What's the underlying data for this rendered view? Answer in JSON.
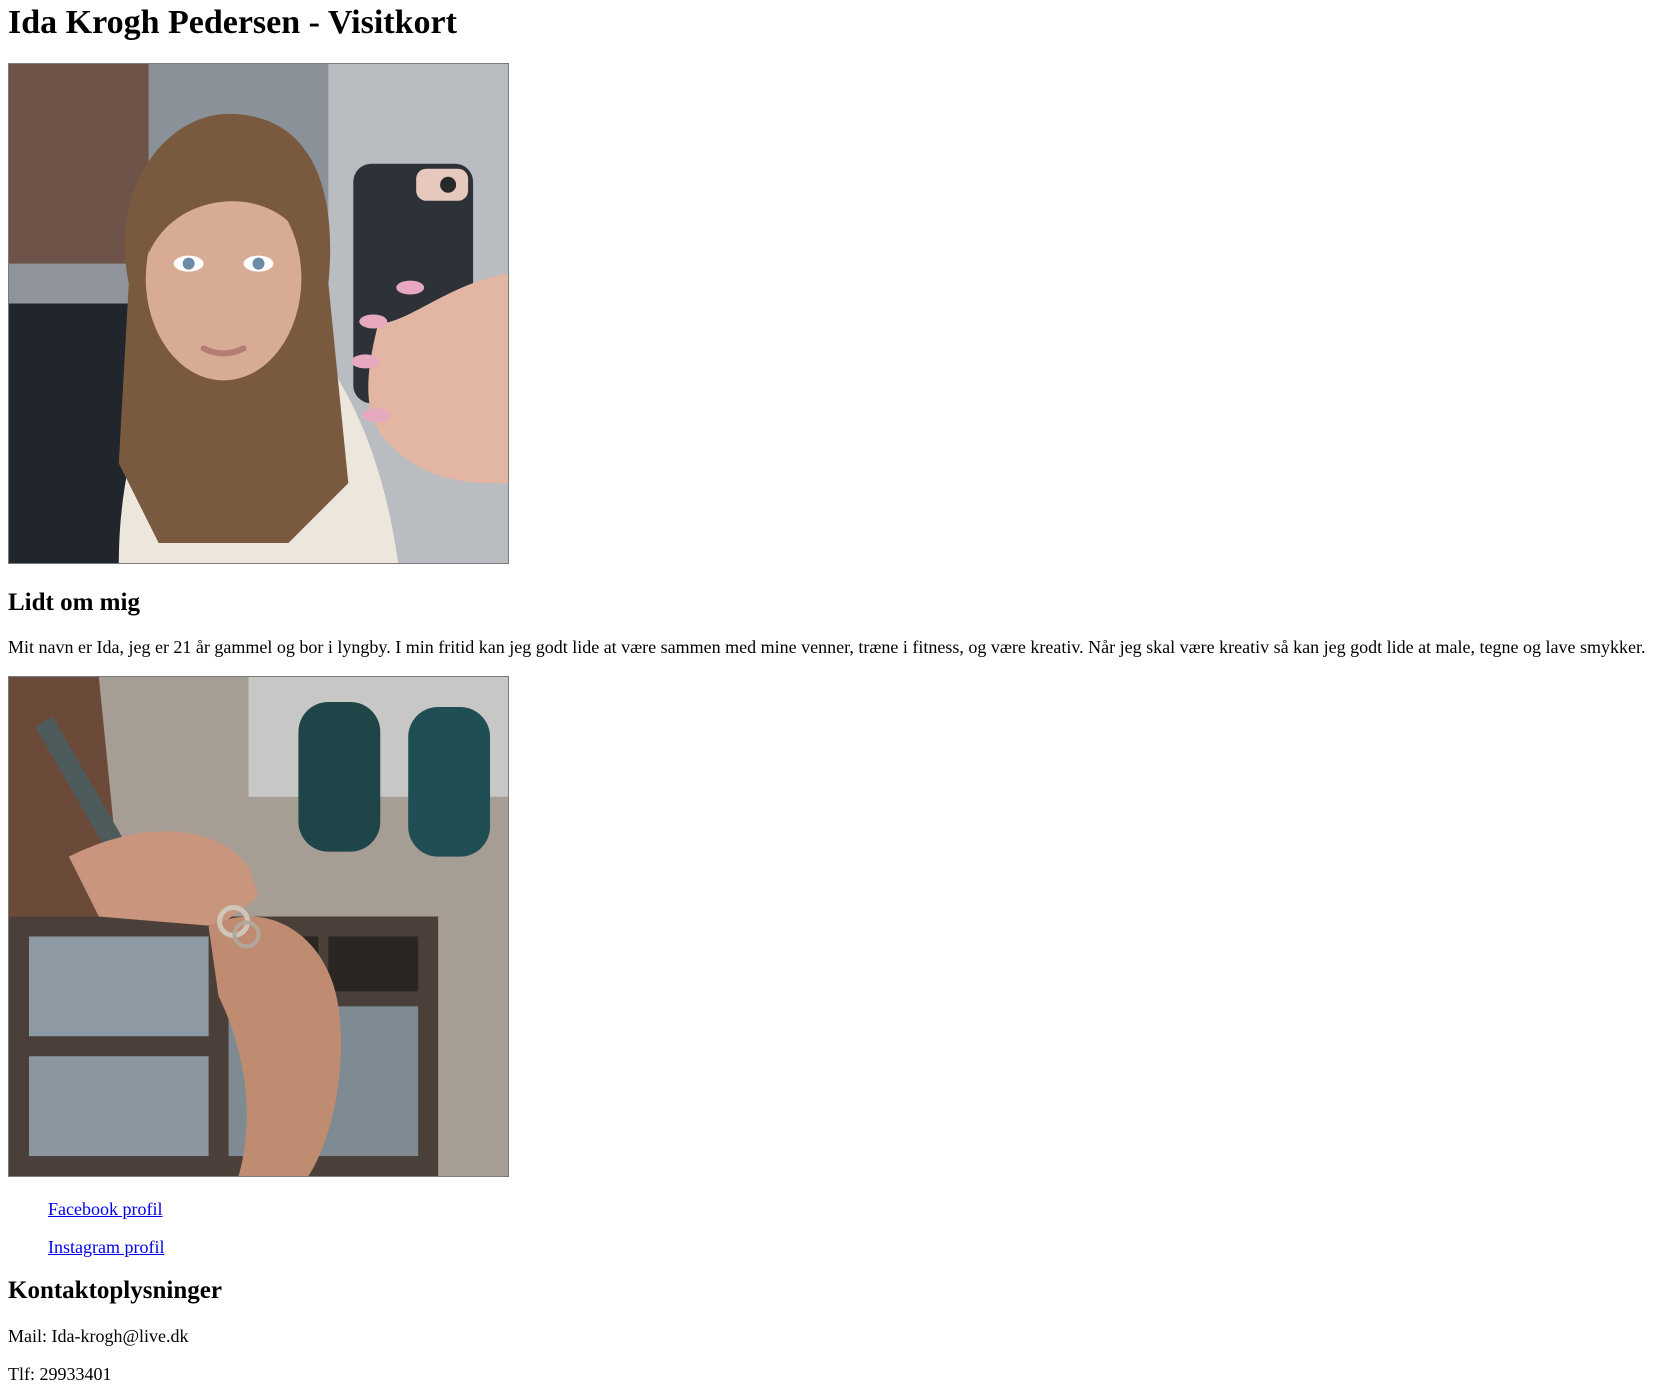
{
  "header": {
    "title": "Ida Krogh Pedersen - Visitkort"
  },
  "about": {
    "heading": "Lidt om mig",
    "text": "Mit navn er Ida, jeg er 21 år gammel og bor i lyngby. I min fritid kan jeg godt lide at være sammen med mine venner, træne i fitness, og være kreativ. Når jeg skal være kreativ så kan jeg godt lide at male, tegne og lave smykker."
  },
  "links": [
    {
      "label": "Facebook profil"
    },
    {
      "label": "Instagram profil"
    }
  ],
  "contact": {
    "heading": "Kontaktoplysninger",
    "mail": "Mail: Ida-krogh@live.dk",
    "phone": "Tlf: 29933401"
  },
  "colors": {
    "link": "#0000ee",
    "text": "#000000",
    "background": "#ffffff"
  }
}
